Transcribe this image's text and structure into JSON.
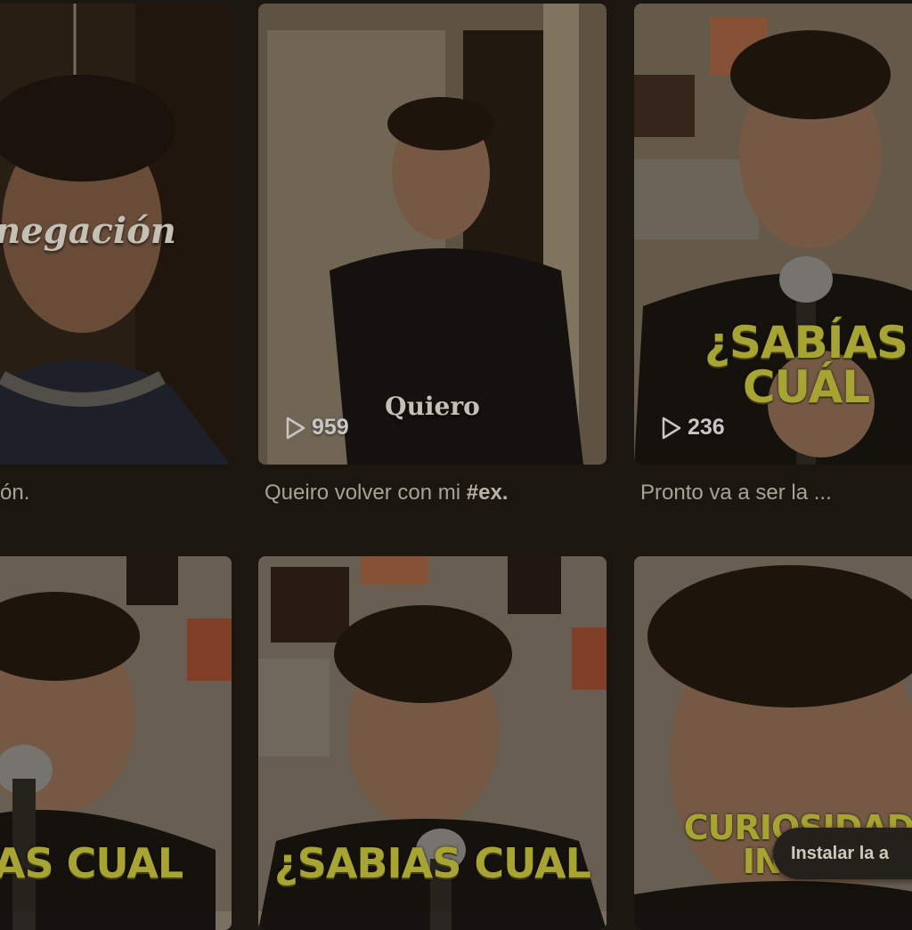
{
  "grid": {
    "row1": [
      {
        "overlay": "negación",
        "views": "",
        "caption": "ón.",
        "caption_tag": ""
      },
      {
        "overlay": "Quiero",
        "views": "959",
        "caption": "Queiro volver con mi ",
        "caption_tag": "#ex."
      },
      {
        "overlay": "¿SABÍAS\nCUÁL",
        "views": "236",
        "caption": "Pronto va a ser la ...",
        "caption_tag": ""
      }
    ],
    "row2": [
      {
        "overlay": "IAS CUAL"
      },
      {
        "overlay": "¿SABIAS CUAL"
      },
      {
        "overlay": "CURIOSIDAD\nINNEC"
      }
    ]
  },
  "install_prompt": {
    "label": "Instalar la a"
  },
  "icons": {
    "play": "play-icon"
  },
  "colors": {
    "caption_overlay": "#c9c53f",
    "background": "#1d1812"
  }
}
